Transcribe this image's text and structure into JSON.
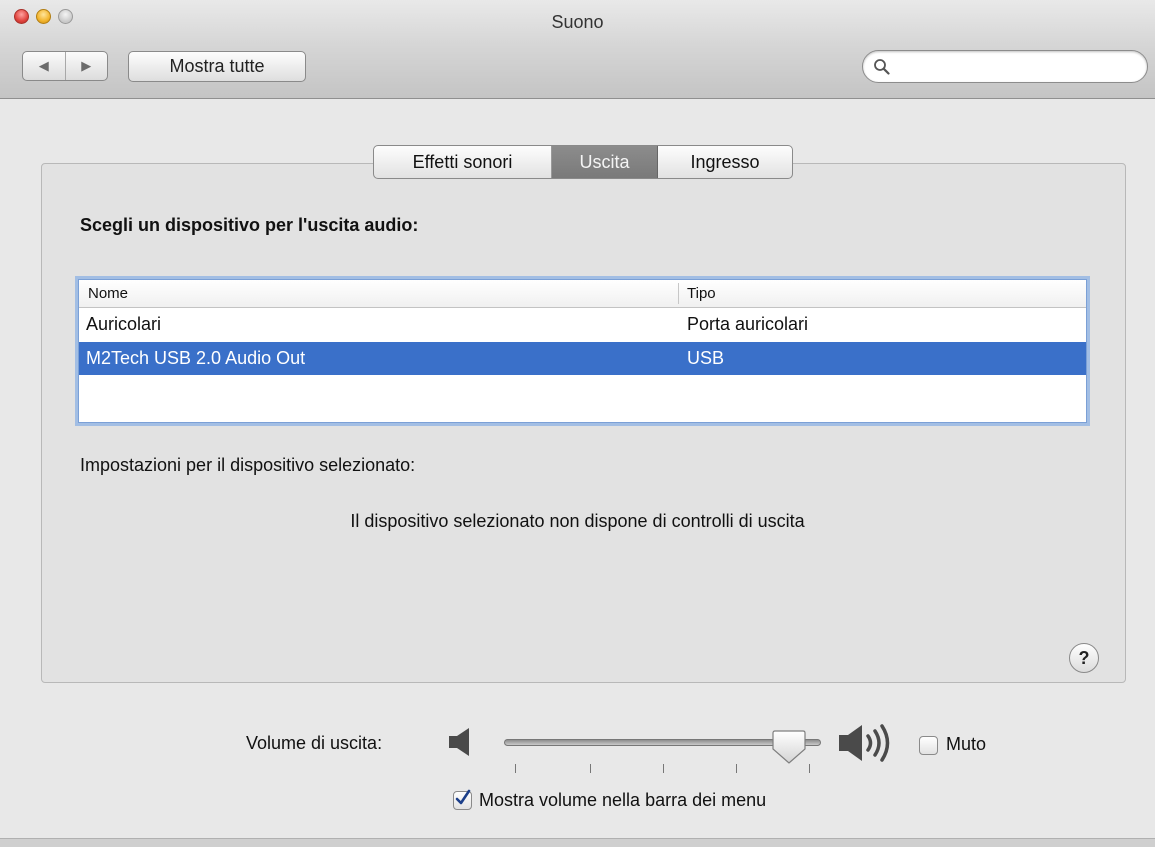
{
  "window": {
    "title": "Suono"
  },
  "toolbar": {
    "back_label": "◀",
    "forward_label": "▶",
    "show_all_label": "Mostra tutte",
    "search_placeholder": "",
    "search_value": ""
  },
  "tabs": [
    {
      "label": "Effetti sonori",
      "selected": false
    },
    {
      "label": "Uscita",
      "selected": true
    },
    {
      "label": "Ingresso",
      "selected": false
    }
  ],
  "output": {
    "heading": "Scegli un dispositivo per l'uscita audio:",
    "columns": {
      "name": "Nome",
      "type": "Tipo"
    },
    "devices": [
      {
        "name": "Auricolari",
        "type": "Porta auricolari",
        "selected": false
      },
      {
        "name": "M2Tech USB 2.0 Audio Out",
        "type": "USB",
        "selected": true
      }
    ],
    "settings_label": "Impostazioni per il dispositivo selezionato:",
    "no_controls_message": "Il dispositivo selezionato non dispone di controlli di uscita",
    "help_label": "?"
  },
  "volume": {
    "label": "Volume di uscita:",
    "level": 0.95,
    "mute_label": "Muto",
    "mute_checked": false,
    "show_in_menubar_label": "Mostra volume nella barra dei menu",
    "show_in_menubar_checked": true
  },
  "colors": {
    "selection": "#3a70c9",
    "selected_tab": "#838383",
    "focus_ring": "#7ba0d6"
  },
  "icons": {
    "close": "close-icon",
    "minimize": "minimize-icon",
    "zoom": "zoom-icon",
    "search": "search-icon",
    "speaker_low": "speaker-low-icon",
    "speaker_high": "speaker-high-icon",
    "checkmark": "checkmark-icon"
  }
}
